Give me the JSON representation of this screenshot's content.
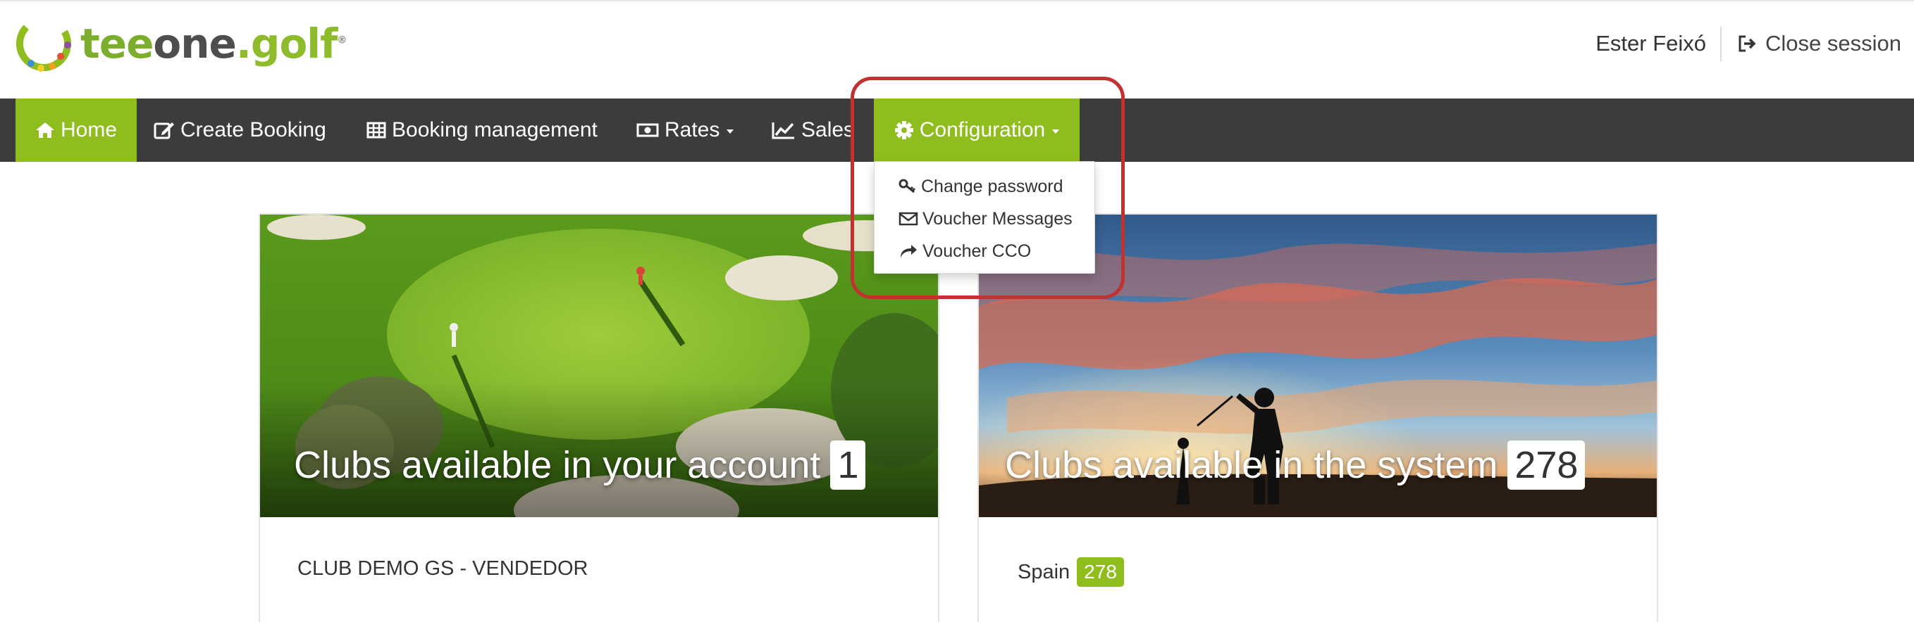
{
  "brand": {
    "logo_tee": "tee",
    "logo_one": "one",
    "logo_golf": ".golf",
    "logo_reg": "®",
    "green": "#8ebd1d"
  },
  "header": {
    "user_name": "Ester Feixó",
    "close_session": "Close session",
    "close_session_icon": "sign-out-icon"
  },
  "nav": {
    "items": [
      {
        "label": "Home",
        "icon": "home-icon",
        "active": true
      },
      {
        "label": "Create Booking",
        "icon": "edit-icon"
      },
      {
        "label": "Booking management",
        "icon": "table-icon"
      },
      {
        "label": "Rates",
        "icon": "money-icon",
        "dropdown": true
      },
      {
        "label": "Sales",
        "icon": "line-chart-icon",
        "dropdown": true
      },
      {
        "label": "Configuration",
        "icon": "gear-icon",
        "dropdown": true,
        "open": true
      }
    ],
    "background": "#3c3c3c"
  },
  "configuration_menu": {
    "items": [
      {
        "label": "Change password",
        "icon": "key-icon"
      },
      {
        "label": "Voucher Messages",
        "icon": "envelope-icon"
      },
      {
        "label": "Voucher CCO",
        "icon": "share-icon"
      }
    ]
  },
  "annotation": {
    "color": "#c0312f"
  },
  "cards": {
    "account": {
      "caption": "Clubs available in your account",
      "count": "1",
      "club_name": "CLUB DEMO GS - VENDEDOR"
    },
    "system": {
      "caption": "Clubs available in the system",
      "count": "278",
      "country": "Spain",
      "country_count": "278"
    }
  }
}
